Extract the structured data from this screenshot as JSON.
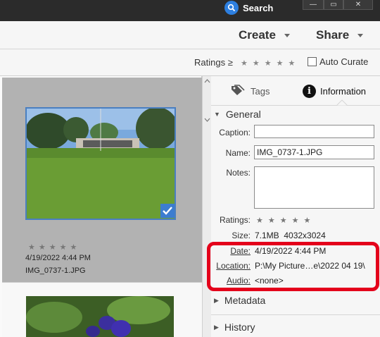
{
  "titlebar": {
    "search_label": "Search",
    "window_buttons": [
      "—",
      "▭",
      "✕"
    ]
  },
  "header": {
    "create_label": "Create",
    "share_label": "Share"
  },
  "ratings_bar": {
    "label": "Ratings",
    "operator": "≥",
    "stars": 5,
    "auto_curate_label": "Auto Curate",
    "auto_curate_checked": false
  },
  "grid": {
    "items": [
      {
        "date": "4/19/2022 4:44 PM",
        "filename": "IMG_0737-1.JPG",
        "rating": 0,
        "selected": true
      }
    ]
  },
  "panel": {
    "tabs": [
      {
        "label": "Tags"
      },
      {
        "label": "Information"
      }
    ],
    "general_label": "General",
    "caption_label": "Caption:",
    "caption_value": "",
    "name_label": "Name:",
    "name_value": "IMG_0737-1.JPG",
    "notes_label": "Notes:",
    "notes_value": "",
    "ratings_label": "Ratings:",
    "size_label": "Size:",
    "size_value": "7.1MB  4032x3024",
    "date_label": "Date:",
    "date_value": "4/19/2022 4:44 PM",
    "location_label": "Location:",
    "location_value": "P:\\My Picture…e\\2022 04 19\\",
    "audio_label": "Audio:",
    "audio_value": "<none>",
    "metadata_label": "Metadata",
    "history_label": "History"
  },
  "colors": {
    "accent": "#2d7fe0",
    "highlight": "#e4001b",
    "selection": "#3c7dd0"
  }
}
